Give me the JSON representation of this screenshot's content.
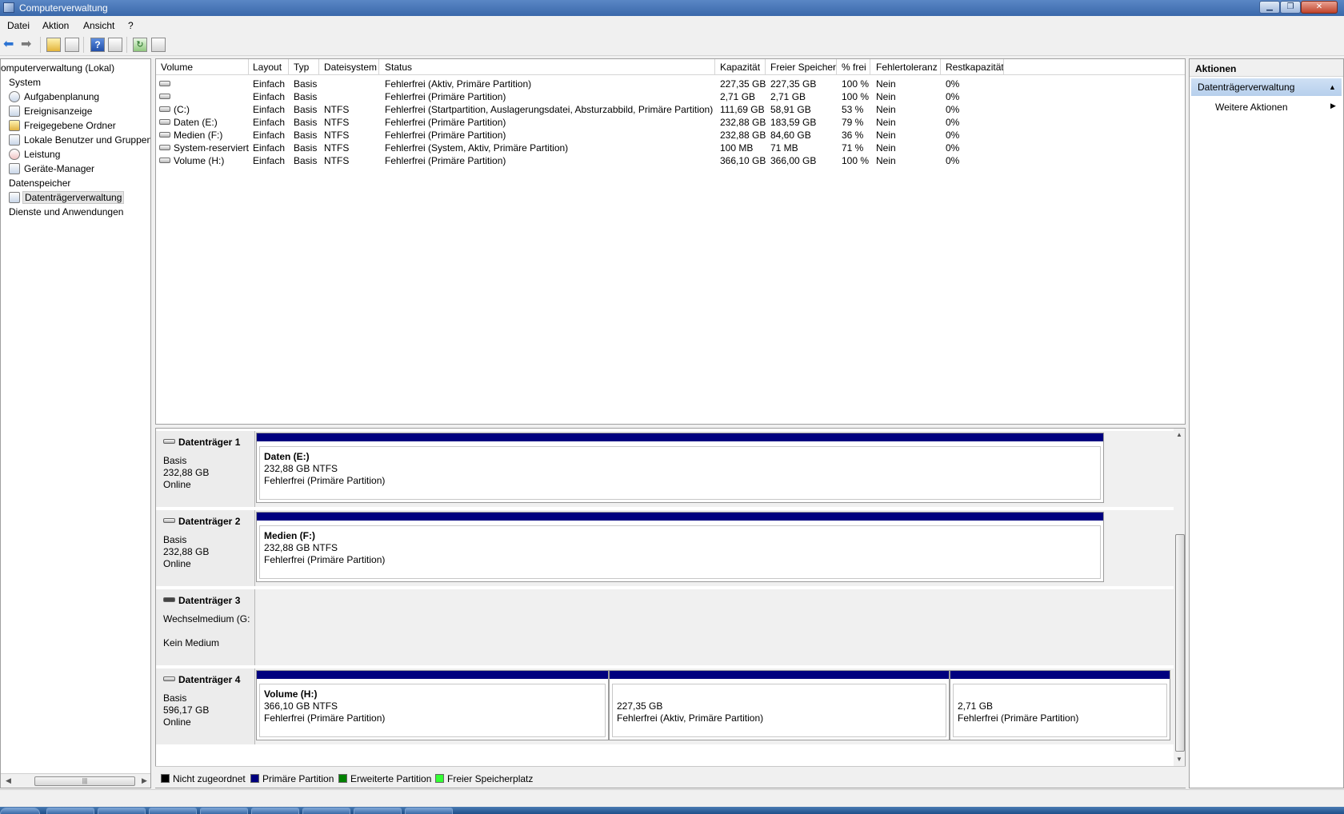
{
  "window": {
    "title": "Computerverwaltung"
  },
  "menu": [
    "Datei",
    "Aktion",
    "Ansicht",
    "?"
  ],
  "tree": {
    "root": "omputerverwaltung (Lokal)",
    "items": [
      {
        "label": "System",
        "level": 0
      },
      {
        "label": "Aufgabenplanung",
        "level": 1
      },
      {
        "label": "Ereignisanzeige",
        "level": 1
      },
      {
        "label": "Freigegebene Ordner",
        "level": 1
      },
      {
        "label": "Lokale Benutzer und Gruppen",
        "level": 1
      },
      {
        "label": "Leistung",
        "level": 1
      },
      {
        "label": "Geräte-Manager",
        "level": 1
      },
      {
        "label": "Datenspeicher",
        "level": 0
      },
      {
        "label": "Datenträgerverwaltung",
        "level": 1,
        "selected": true
      },
      {
        "label": "Dienste und Anwendungen",
        "level": 0
      }
    ]
  },
  "volume_table": {
    "columns": [
      "Volume",
      "Layout",
      "Typ",
      "Dateisystem",
      "Status",
      "Kapazität",
      "Freier Speicher",
      "% frei",
      "Fehlertoleranz",
      "Restkapazität"
    ],
    "rows": [
      [
        "",
        "Einfach",
        "Basis",
        "",
        "Fehlerfrei (Aktiv, Primäre Partition)",
        "227,35 GB",
        "227,35 GB",
        "100 %",
        "Nein",
        "0%"
      ],
      [
        "",
        "Einfach",
        "Basis",
        "",
        "Fehlerfrei (Primäre Partition)",
        "2,71 GB",
        "2,71 GB",
        "100 %",
        "Nein",
        "0%"
      ],
      [
        "(C:)",
        "Einfach",
        "Basis",
        "NTFS",
        "Fehlerfrei (Startpartition, Auslagerungsdatei, Absturzabbild, Primäre Partition)",
        "111,69 GB",
        "58,91 GB",
        "53 %",
        "Nein",
        "0%"
      ],
      [
        "Daten (E:)",
        "Einfach",
        "Basis",
        "NTFS",
        "Fehlerfrei (Primäre Partition)",
        "232,88 GB",
        "183,59 GB",
        "79 %",
        "Nein",
        "0%"
      ],
      [
        "Medien (F:)",
        "Einfach",
        "Basis",
        "NTFS",
        "Fehlerfrei (Primäre Partition)",
        "232,88 GB",
        "84,60 GB",
        "36 %",
        "Nein",
        "0%"
      ],
      [
        "System-reserviert",
        "Einfach",
        "Basis",
        "NTFS",
        "Fehlerfrei (System, Aktiv, Primäre Partition)",
        "100 MB",
        "71 MB",
        "71 %",
        "Nein",
        "0%"
      ],
      [
        "Volume (H:)",
        "Einfach",
        "Basis",
        "NTFS",
        "Fehlerfrei (Primäre Partition)",
        "366,10 GB",
        "366,00 GB",
        "100 %",
        "Nein",
        "0%"
      ]
    ]
  },
  "disks": [
    {
      "name": "Datenträger 1",
      "lines": [
        "Basis",
        "232,88 GB",
        "Online"
      ],
      "partitions": [
        {
          "title": "Daten  (E:)",
          "size": "232,88 GB NTFS",
          "status": "Fehlerfrei (Primäre Partition)"
        }
      ]
    },
    {
      "name": "Datenträger 2",
      "lines": [
        "Basis",
        "232,88 GB",
        "Online"
      ],
      "partitions": [
        {
          "title": "Medien  (F:)",
          "size": "232,88 GB NTFS",
          "status": "Fehlerfrei (Primäre Partition)"
        }
      ]
    },
    {
      "name": "Datenträger 3",
      "lines": [
        "Wechselmedium (G:",
        "Kein Medium"
      ],
      "partitions": []
    },
    {
      "name": "Datenträger 4",
      "lines": [
        "Basis",
        "596,17 GB",
        "Online"
      ],
      "partitions": [
        {
          "title": "Volume  (H:)",
          "size": "366,10 GB NTFS",
          "status": "Fehlerfrei (Primäre Partition)"
        },
        {
          "title": "",
          "size": "227,35 GB",
          "status": "Fehlerfrei (Aktiv, Primäre Partition)"
        },
        {
          "title": "",
          "size": "2,71 GB",
          "status": "Fehlerfrei (Primäre Partition)"
        }
      ]
    }
  ],
  "legend": [
    {
      "label": "Nicht zugeordnet",
      "color": "#000000"
    },
    {
      "label": "Primäre Partition",
      "color": "#00007f"
    },
    {
      "label": "Erweiterte Partition",
      "color": "#008000"
    },
    {
      "label": "Freier Speicherplatz",
      "color": "#33ff33"
    }
  ],
  "actions": {
    "header": "Aktionen",
    "section": "Datenträgerverwaltung",
    "more": "Weitere Aktionen"
  },
  "colors": {
    "primary_partition": "#00007f",
    "titlebar": "#3a68aa"
  }
}
